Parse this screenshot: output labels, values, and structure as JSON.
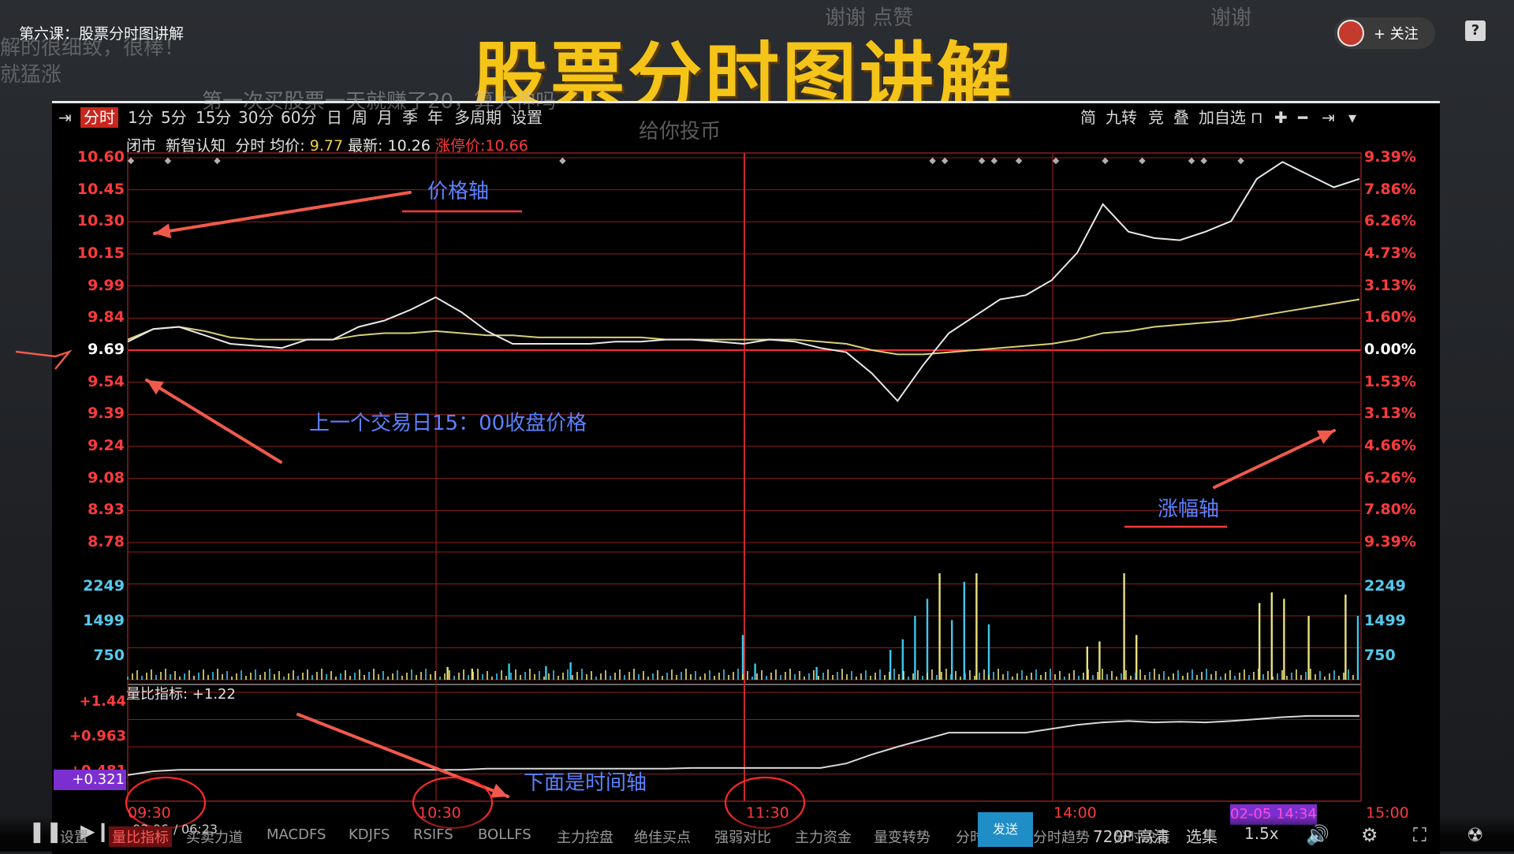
{
  "course_title": "第六课：股票分时图讲解",
  "banner_title": "股票分时图讲解",
  "danmaku": [
    "解的很细致，很棒！",
    "就猛涨",
    "谢谢  点赞",
    "谢谢",
    "第一次买股票一天就赚了20，算大神吗",
    "给你投币"
  ],
  "follow_label": "+ 关注",
  "help_label": "?",
  "toolbar": {
    "items": [
      "分时",
      "1分",
      "5分",
      "15分",
      "30分",
      "60分",
      "日",
      "周",
      "月",
      "季",
      "年",
      "多周期",
      "设置"
    ],
    "right_items": [
      "简",
      "九转",
      "竞",
      "叠",
      "加自选"
    ]
  },
  "stock_info": {
    "status": "闭市",
    "name": "新智认知",
    "mode": "分时",
    "avg_label": "均价:",
    "avg_value": "9.77",
    "latest_label": "最新:",
    "latest_value": "10.26",
    "limit_label": "涨停价:",
    "limit_value": "10.66"
  },
  "price_axis": [
    "10.60",
    "10.45",
    "10.30",
    "10.15",
    "9.99",
    "9.84",
    "9.69",
    "9.54",
    "9.39",
    "9.24",
    "9.08",
    "8.93",
    "8.78"
  ],
  "pct_axis": [
    "9.39%",
    "7.86%",
    "6.26%",
    "4.73%",
    "3.13%",
    "1.60%",
    "0.00%",
    "1.53%",
    "3.13%",
    "4.66%",
    "6.26%",
    "7.80%",
    "9.39%"
  ],
  "volume_axis": [
    "2249",
    "1499",
    "750"
  ],
  "ratio": {
    "label": "量比指标: +1.22",
    "axis": [
      "+1.44",
      "+0.963",
      "+0.481"
    ],
    "current": "+0.321"
  },
  "time_axis": [
    "09:30",
    "10:30",
    "11:30",
    "14:00",
    "15:00"
  ],
  "date_badge": "02-05 14:34",
  "annotations": {
    "price_axis": "价格轴",
    "prev_close": "上一个交易日15：00收盘价格",
    "pct_axis": "涨幅轴",
    "time_axis": "下面是时间轴"
  },
  "player": {
    "time_current": "03:06",
    "time_total": "06:23",
    "quality": "720P 高清",
    "episodes": "选集",
    "speed": "1.5x",
    "send": "发送"
  },
  "bottom_tabs": [
    "设置",
    "量比指标",
    "买卖力道",
    "MACDFS",
    "KDJFS",
    "RSIFS",
    "BOLLFS",
    "主力控盘",
    "绝佳买点",
    "强弱对比",
    "主力资金",
    "量变转势",
    "分时大单",
    "分时趋势",
    "分时决策"
  ],
  "colors": {
    "price_line": "#e8e8e8",
    "avg_line": "#d8d07a",
    "grid": "#8a1e1e",
    "volume_up": "#e9e27a",
    "volume_down": "#3fc7ee",
    "ratio_line": "#d8d8d8",
    "arrow": "#f05a4c",
    "annotation": "#5b82ff",
    "title": "#f5c419"
  },
  "series": {
    "price": [
      9.73,
      9.79,
      9.8,
      9.76,
      9.72,
      9.71,
      9.7,
      9.74,
      9.74,
      9.8,
      9.83,
      9.88,
      9.94,
      9.87,
      9.78,
      9.72,
      9.72,
      9.72,
      9.72,
      9.73,
      9.73,
      9.74,
      9.74,
      9.73,
      9.72,
      9.74,
      9.73,
      9.7,
      9.68,
      9.58,
      9.45,
      9.62,
      9.77,
      9.85,
      9.93,
      9.95,
      10.02,
      10.15,
      10.38,
      10.25,
      10.22,
      10.21,
      10.25,
      10.3,
      10.5,
      10.58,
      10.52,
      10.46,
      10.5
    ],
    "avg": [
      9.74,
      9.79,
      9.8,
      9.78,
      9.75,
      9.74,
      9.74,
      9.74,
      9.74,
      9.76,
      9.77,
      9.77,
      9.78,
      9.77,
      9.76,
      9.76,
      9.75,
      9.75,
      9.75,
      9.75,
      9.75,
      9.74,
      9.74,
      9.74,
      9.74,
      9.74,
      9.74,
      9.73,
      9.72,
      9.69,
      9.67,
      9.67,
      9.68,
      9.69,
      9.7,
      9.71,
      9.72,
      9.74,
      9.77,
      9.78,
      9.8,
      9.81,
      9.82,
      9.83,
      9.85,
      9.87,
      9.89,
      9.91,
      9.93
    ],
    "ratio": [
      0.3,
      0.36,
      0.38,
      0.38,
      0.38,
      0.38,
      0.38,
      0.38,
      0.38,
      0.38,
      0.38,
      0.38,
      0.38,
      0.38,
      0.4,
      0.4,
      0.4,
      0.4,
      0.4,
      0.4,
      0.4,
      0.4,
      0.41,
      0.41,
      0.41,
      0.41,
      0.41,
      0.41,
      0.48,
      0.62,
      0.74,
      0.85,
      0.96,
      0.96,
      0.96,
      0.96,
      1.02,
      1.08,
      1.12,
      1.14,
      1.12,
      1.13,
      1.12,
      1.14,
      1.17,
      1.2,
      1.22,
      1.22,
      1.22
    ],
    "volume_spikes": [
      {
        "t": 0.26,
        "v": 300,
        "up": true
      },
      {
        "t": 0.28,
        "v": 260,
        "up": true
      },
      {
        "t": 0.31,
        "v": 380,
        "up": false
      },
      {
        "t": 0.34,
        "v": 320,
        "up": false
      },
      {
        "t": 0.36,
        "v": 410,
        "up": false
      },
      {
        "t": 0.5,
        "v": 1050,
        "up": false
      },
      {
        "t": 0.51,
        "v": 380,
        "up": false
      },
      {
        "t": 0.56,
        "v": 300,
        "up": false
      },
      {
        "t": 0.62,
        "v": 700,
        "up": false
      },
      {
        "t": 0.63,
        "v": 950,
        "up": false
      },
      {
        "t": 0.64,
        "v": 1500,
        "up": false
      },
      {
        "t": 0.65,
        "v": 1900,
        "up": false
      },
      {
        "t": 0.66,
        "v": 2500,
        "up": true
      },
      {
        "t": 0.67,
        "v": 1400,
        "up": false
      },
      {
        "t": 0.68,
        "v": 2300,
        "up": false
      },
      {
        "t": 0.69,
        "v": 2500,
        "up": true
      },
      {
        "t": 0.7,
        "v": 1300,
        "up": false
      },
      {
        "t": 0.78,
        "v": 780,
        "up": true
      },
      {
        "t": 0.79,
        "v": 900,
        "up": true
      },
      {
        "t": 0.81,
        "v": 2500,
        "up": true
      },
      {
        "t": 0.82,
        "v": 1050,
        "up": true
      },
      {
        "t": 0.92,
        "v": 1800,
        "up": true
      },
      {
        "t": 0.93,
        "v": 2050,
        "up": true
      },
      {
        "t": 0.94,
        "v": 1900,
        "up": true
      },
      {
        "t": 0.96,
        "v": 1500,
        "up": true
      },
      {
        "t": 0.99,
        "v": 2000,
        "up": true
      },
      {
        "t": 1.0,
        "v": 1500,
        "up": false
      }
    ]
  }
}
